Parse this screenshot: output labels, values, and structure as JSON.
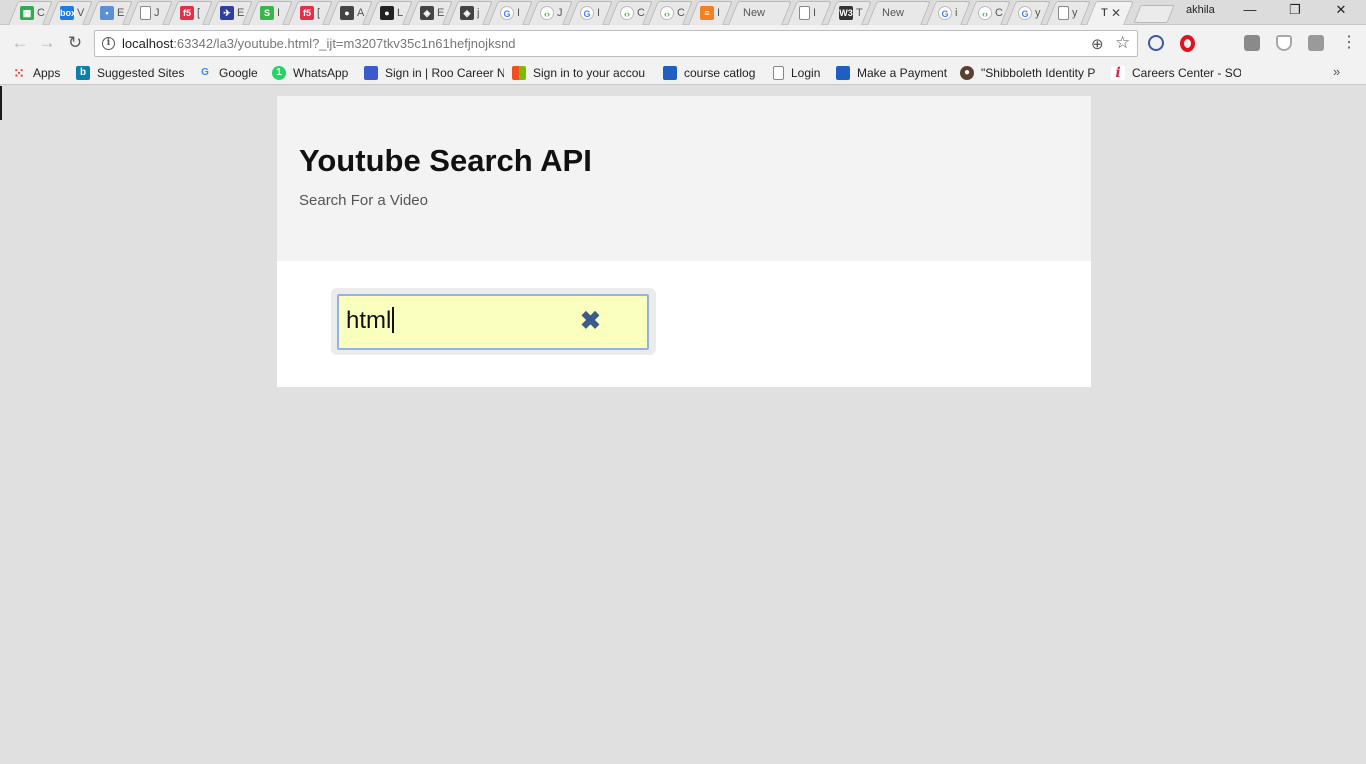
{
  "browser": {
    "tabs": [
      {
        "icon": "sheets-icon",
        "color": "#34a853",
        "glyph": "▦",
        "title": "C"
      },
      {
        "icon": "box-icon",
        "color": "#1d7ce0",
        "glyph": "box",
        "title": "V"
      },
      {
        "icon": "trello-icon",
        "color": "#5b8fd6",
        "glyph": "▪",
        "title": "E"
      },
      {
        "icon": "page-icon",
        "color": "#9e9e9e",
        "glyph": "",
        "title": "J"
      },
      {
        "icon": "f5-icon",
        "color": "#e2304a",
        "glyph": "f5",
        "title": "["
      },
      {
        "icon": "plane-icon",
        "color": "#2f3fa0",
        "glyph": "✈",
        "title": "E"
      },
      {
        "icon": "s-icon",
        "color": "#3bb54a",
        "glyph": "S",
        "title": "I"
      },
      {
        "icon": "f5-icon",
        "color": "#e2304a",
        "glyph": "f5",
        "title": "["
      },
      {
        "icon": "lock-icon",
        "color": "#444444",
        "glyph": "●",
        "title": "A"
      },
      {
        "icon": "github-icon",
        "color": "#222222",
        "glyph": "●",
        "title": "L"
      },
      {
        "icon": "codepen-icon",
        "color": "#444444",
        "glyph": "◈",
        "title": "E"
      },
      {
        "icon": "codepen-icon",
        "color": "#444444",
        "glyph": "◈",
        "title": "j"
      },
      {
        "icon": "google-icon",
        "color": "#4285f4",
        "glyph": "G",
        "title": "I"
      },
      {
        "icon": "code-icon",
        "color": "#4caf50",
        "glyph": "‹›",
        "title": "J"
      },
      {
        "icon": "google-icon",
        "color": "#4285f4",
        "glyph": "G",
        "title": "I"
      },
      {
        "icon": "code-icon",
        "color": "#4caf50",
        "glyph": "‹›",
        "title": "C"
      },
      {
        "icon": "code-icon",
        "color": "#4caf50",
        "glyph": "‹›",
        "title": "C"
      },
      {
        "icon": "stackoverflow-icon",
        "color": "#f48024",
        "glyph": "≡",
        "title": "I"
      },
      {
        "icon": "none",
        "color": "#e8e8e8",
        "glyph": "",
        "title": "New",
        "wide": true
      },
      {
        "icon": "page-icon",
        "color": "#9e9e9e",
        "glyph": "",
        "title": "I"
      },
      {
        "icon": "w3-icon",
        "color": "#333333",
        "glyph": "W3",
        "title": "T"
      },
      {
        "icon": "none",
        "color": "#e8e8e8",
        "glyph": "",
        "title": "New",
        "wide": true
      },
      {
        "icon": "google-icon",
        "color": "#4285f4",
        "glyph": "G",
        "title": "i"
      },
      {
        "icon": "code-icon",
        "color": "#4caf50",
        "glyph": "‹›",
        "title": "C"
      },
      {
        "icon": "google-icon",
        "color": "#4285f4",
        "glyph": "G",
        "title": "y"
      },
      {
        "icon": "page-icon",
        "color": "#9e9e9e",
        "glyph": "",
        "title": "y"
      }
    ],
    "active_tab": {
      "title": "T",
      "close": "✕"
    },
    "profile_name": "akhila",
    "window_controls": {
      "minimize": "—",
      "restore": "❐",
      "close": "✕"
    },
    "nav": {
      "back": "←",
      "forward": "→",
      "reload": "↻"
    },
    "address": {
      "info": "i",
      "host": "localhost",
      "rest": ":63342/la3/youtube.html?_ijt=m3207tkv35c1n61hefjnojksnd"
    },
    "address_icons": {
      "zoom": "⊕",
      "star": "☆"
    },
    "extensions": [
      {
        "name": "block-icon",
        "color": "#3a5ba0"
      },
      {
        "name": "opera-icon",
        "color": "#e0131e"
      },
      {
        "name": "ext-m-icon",
        "color": "#8a8a8a"
      },
      {
        "name": "shield-icon",
        "color": "#a8a8a8"
      },
      {
        "name": "ext-square-icon",
        "color": "#9a9a9a"
      }
    ],
    "menu": "⋮",
    "bookmarks": [
      {
        "icon": "apps-icon",
        "color": "#e94235",
        "glyph": "⁙",
        "label": "Apps"
      },
      {
        "icon": "bing-icon",
        "color": "#0f7ea8",
        "glyph": "b",
        "label": "Suggested Sites"
      },
      {
        "icon": "google-icon",
        "color": "#4285f4",
        "glyph": "G",
        "label": "Google"
      },
      {
        "icon": "whatsapp-icon",
        "color": "#25d366",
        "glyph": "1",
        "label": "WhatsApp"
      },
      {
        "icon": "roo-icon",
        "color": "#3b5bcc",
        "glyph": "",
        "label": "Sign in | Roo Career N"
      },
      {
        "icon": "microsoft-icon",
        "color": "#f25022",
        "glyph": "",
        "label": "Sign in to your accou"
      },
      {
        "icon": "bookmark-blue-icon",
        "color": "#1f5fbf",
        "glyph": "",
        "label": "course catlog"
      },
      {
        "icon": "page-icon",
        "color": "#ffffff",
        "glyph": "",
        "label": "Login"
      },
      {
        "icon": "bookmark-blue-icon",
        "color": "#1f5fbf",
        "glyph": "",
        "label": "Make a Payment"
      },
      {
        "icon": "shibboleth-icon",
        "color": "#5a4030",
        "glyph": "●",
        "label": "\"Shibboleth Identity P"
      },
      {
        "icon": "info-italic-icon",
        "color": "#ffffff",
        "glyph": "i",
        "label": "Careers Center - SOF"
      }
    ],
    "bookmarks_more": "»"
  },
  "page": {
    "title": "Youtube Search API",
    "subtitle": "Search For a Video",
    "search": {
      "value": "html",
      "clear": "✖"
    }
  }
}
